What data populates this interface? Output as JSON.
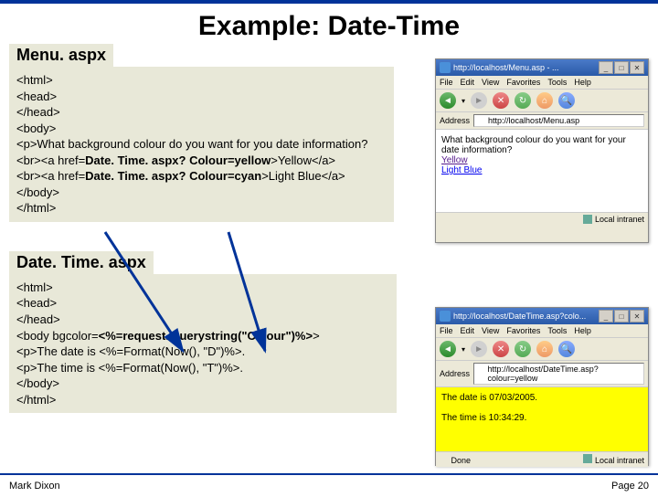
{
  "slide": {
    "title": "Example: Date-Time",
    "section1_label": "Menu. aspx",
    "section2_label": "Date. Time. aspx",
    "footer_left": "Mark Dixon",
    "footer_right": "Page 20"
  },
  "code1": {
    "l1": "<html>",
    "l2": " <head>",
    "l3": " </head>",
    "l4": " <body>",
    "l5": "  <p>What background colour do you want for you date information?",
    "l6_a": "   <br><a href=",
    "l6_b": "Date. Time. aspx? Colour=yellow",
    "l6_c": ">Yellow</a>",
    "l7_a": "   <br><a href=",
    "l7_b": "Date. Time. aspx? Colour=cyan",
    "l7_c": ">Light Blue</a>",
    "l8": " </body>",
    "l9": "</html>"
  },
  "code2": {
    "l1": "<html>",
    "l2": " <head>",
    "l3": " </head>",
    "l4_a": " <body bgcolor=",
    "l4_b": "<%=request. querystring(\"Colour\")%>",
    "l4_c": ">",
    "l5": "  <p>The date is <%=Format(Now(), \"D\")%>.",
    "l6": "  <p>The time is <%=Format(Now(), \"T\")%>.",
    "l7": " </body>",
    "l8": "</html>"
  },
  "browser1": {
    "title": "http://localhost/Menu.asp - ...",
    "menu": {
      "file": "File",
      "edit": "Edit",
      "view": "View",
      "favorites": "Favorites",
      "tools": "Tools",
      "help": "Help"
    },
    "address_label": "Address",
    "address_value": "http://localhost/Menu.asp",
    "content_q": "What background colour do you want for your date information?",
    "link1": "Yellow",
    "link2": "Light Blue",
    "status": "Local intranet"
  },
  "browser2": {
    "title": "http://localhost/DateTime.asp?colo...",
    "menu": {
      "file": "File",
      "edit": "Edit",
      "view": "View",
      "favorites": "Favorites",
      "tools": "Tools",
      "help": "Help"
    },
    "address_label": "Address",
    "address_value": "http://localhost/DateTime.asp?colour=yellow",
    "line1": "The date is 07/03/2005.",
    "line2": "The time is 10:34:29.",
    "status_left": "Done",
    "status_right": "Local intranet"
  },
  "icons": {
    "back": "◄",
    "fwd": "►",
    "stop": "✕",
    "refresh": "↻",
    "home": "⌂",
    "search": "🔍",
    "min": "_",
    "max": "□",
    "close": "✕",
    "dropdown": "▾"
  }
}
